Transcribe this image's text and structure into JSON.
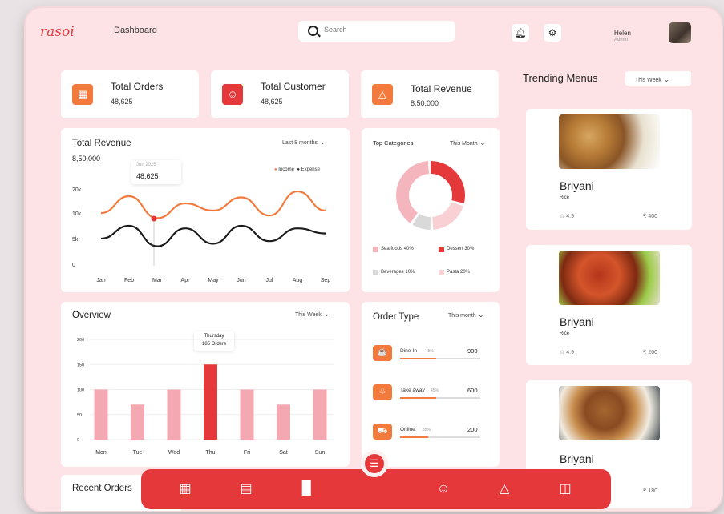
{
  "header": {
    "logo": "rasoi",
    "title": "Dashboard",
    "search_placeholder": "Search",
    "user_name": "Helen",
    "user_role": "Admin"
  },
  "stats": [
    {
      "label": "Total Orders",
      "value": "48,625",
      "icon": "receipt-icon",
      "color": "#f37a3d"
    },
    {
      "label": "Total Customer",
      "value": "48,625",
      "icon": "customers-icon",
      "color": "#e5383b"
    },
    {
      "label": "Total Revenue",
      "value": "8,50,000",
      "icon": "revenue-icon",
      "color": "#f37a3d"
    }
  ],
  "revenue": {
    "title": "Total Revenue",
    "total": "8,50,000",
    "filter": "Last 8 months",
    "tooltip_date": "Jun 2025",
    "tooltip_value": "48,625",
    "legend_income": "Income",
    "legend_expense": "Expense"
  },
  "categories": {
    "title": "Top Categories",
    "filter": "This Month",
    "items": [
      {
        "label": "Sea foods 40%",
        "color": "#f4b5bd"
      },
      {
        "label": "Dessert 30%",
        "color": "#e5383b"
      },
      {
        "label": "Beverages 10%",
        "color": "#d9d9d9"
      },
      {
        "label": "Pasta 20%",
        "color": "#f9d1d5"
      }
    ]
  },
  "overview": {
    "title": "Overview",
    "filter": "This Week",
    "tooltip_day": "Thursday",
    "tooltip_orders": "185 Orders"
  },
  "order_type": {
    "title": "Order Type",
    "filter": "This month",
    "items": [
      {
        "name": "Dine-In",
        "pct": "45%",
        "value": "900",
        "fill": 0.45,
        "icon": "dine-in-icon"
      },
      {
        "name": "Take away",
        "pct": "45%",
        "value": "600",
        "fill": 0.45,
        "icon": "takeaway-icon"
      },
      {
        "name": "Online",
        "pct": "35%",
        "value": "200",
        "fill": 0.35,
        "icon": "delivery-icon"
      }
    ]
  },
  "recent_orders": {
    "title": "Recent Orders"
  },
  "trending": {
    "title": "Trending Menus",
    "filter": "This Week",
    "items": [
      {
        "name": "Briyani",
        "category": "Rice",
        "rating": "4.9",
        "price": "₹ 400"
      },
      {
        "name": "Briyani",
        "category": "Rice",
        "rating": "4.9",
        "price": "₹ 200"
      },
      {
        "name": "Briyani",
        "category": "",
        "rating": "",
        "price": "₹ 180"
      }
    ]
  },
  "chart_data": [
    {
      "type": "line",
      "title": "Total Revenue",
      "x": [
        "Jan",
        "Feb",
        "Mar",
        "Apr",
        "May",
        "Jun",
        "Jul",
        "Aug",
        "Sep"
      ],
      "y_ticks": [
        "0",
        "5k",
        "10k",
        "20k"
      ],
      "series": [
        {
          "name": "Income",
          "color": "#f37a3d",
          "values": [
            10000,
            17000,
            9000,
            14000,
            11000,
            16500,
            9500,
            19000,
            11000
          ]
        },
        {
          "name": "Expense",
          "color": "#1b1b1b",
          "values": [
            5000,
            7500,
            3500,
            7000,
            4000,
            7500,
            4500,
            7000,
            6000
          ]
        }
      ]
    },
    {
      "type": "pie",
      "title": "Top Categories",
      "categories": [
        "Sea foods",
        "Dessert",
        "Beverages",
        "Pasta"
      ],
      "values": [
        40,
        30,
        10,
        20
      ]
    },
    {
      "type": "bar",
      "title": "Overview",
      "categories": [
        "Mon",
        "Tue",
        "Wed",
        "Thu",
        "Fri",
        "Sat",
        "Sun"
      ],
      "values": [
        100,
        70,
        100,
        150,
        100,
        70,
        100
      ],
      "highlight": "Thu",
      "y_ticks": [
        "0",
        "50",
        "100",
        "150",
        "200"
      ],
      "ylim": [
        0,
        200
      ]
    }
  ]
}
